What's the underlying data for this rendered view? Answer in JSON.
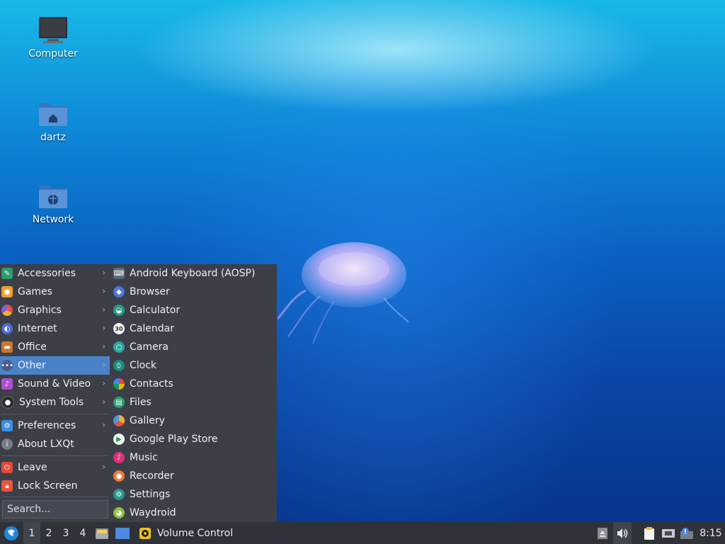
{
  "desktop": {
    "icons": [
      {
        "label": "Computer",
        "icon": "computer-icon"
      },
      {
        "label": "dartz",
        "icon": "home-folder-icon"
      },
      {
        "label": "Network",
        "icon": "network-folder-icon"
      }
    ]
  },
  "menu": {
    "categories": [
      {
        "label": "Accessories",
        "icon": "accessories-icon",
        "color": "#2f9b6e",
        "submenu": true
      },
      {
        "label": "Games",
        "icon": "games-icon",
        "color": "#f0a030",
        "submenu": true
      },
      {
        "label": "Graphics",
        "icon": "graphics-icon",
        "color": "#e8533f",
        "submenu": true
      },
      {
        "label": "Internet",
        "icon": "internet-icon",
        "color": "#4a6cd8",
        "submenu": true
      },
      {
        "label": "Office",
        "icon": "office-icon",
        "color": "#c8782c",
        "submenu": true
      },
      {
        "label": "Other",
        "icon": "other-icon",
        "color": "#4d5d8a",
        "submenu": true,
        "selected": true
      },
      {
        "label": "Sound & Video",
        "icon": "sound-video-icon",
        "color": "#b04fd0",
        "submenu": true
      },
      {
        "label": "System Tools",
        "icon": "system-tools-icon",
        "color": "#3a3d44",
        "submenu": true
      }
    ],
    "preferences": {
      "label": "Preferences",
      "icon": "preferences-icon",
      "color": "#3d8ee0"
    },
    "about": {
      "label": "About LXQt",
      "icon": "info-icon",
      "color": "#7a7d84"
    },
    "leave": {
      "label": "Leave",
      "icon": "power-icon",
      "color": "#e04a3a"
    },
    "lock": {
      "label": "Lock Screen",
      "icon": "lock-icon",
      "color": "#e8553a"
    },
    "search_placeholder": "Search...",
    "apps": [
      {
        "label": "Android Keyboard (AOSP)",
        "icon": "keyboard-icon",
        "color": "#5a6b78"
      },
      {
        "label": "Browser",
        "icon": "browser-icon",
        "color": "#4a78d8"
      },
      {
        "label": "Calculator",
        "icon": "calculator-icon",
        "color": "#2a9a8a"
      },
      {
        "label": "Calendar",
        "icon": "calendar-icon",
        "color": "#f2f2f2",
        "badge": "30"
      },
      {
        "label": "Camera",
        "icon": "camera-icon",
        "color": "#2aa8a0"
      },
      {
        "label": "Clock",
        "icon": "clock-icon",
        "color": "#1f8a7a"
      },
      {
        "label": "Contacts",
        "icon": "contacts-icon",
        "color": "#f2f2f2"
      },
      {
        "label": "Files",
        "icon": "files-icon",
        "color": "#2aa070"
      },
      {
        "label": "Gallery",
        "icon": "gallery-icon",
        "color": "#f0b030"
      },
      {
        "label": "Google Play Store",
        "icon": "play-store-icon",
        "color": "#f2f2f2"
      },
      {
        "label": "Music",
        "icon": "music-icon",
        "color": "#e0307a"
      },
      {
        "label": "Recorder",
        "icon": "recorder-icon",
        "color": "#f07a30"
      },
      {
        "label": "Settings",
        "icon": "settings-icon",
        "color": "#2a9a8a"
      },
      {
        "label": "Waydroid",
        "icon": "waydroid-icon",
        "color": "#8ac040"
      }
    ]
  },
  "taskbar": {
    "start_icon": "lxqt-start-icon",
    "workspaces": [
      "1",
      "2",
      "3",
      "4"
    ],
    "active_workspace": "1",
    "quicklaunch": [
      "file-manager-icon",
      "show-desktop-icon"
    ],
    "task": {
      "label": "Volume Control",
      "icon": "volume-control-icon"
    },
    "tray": [
      "eject-icon",
      "speaker-icon",
      "clipboard-icon",
      "network-icon",
      "update-notifier-icon"
    ],
    "clock": "8:15"
  }
}
